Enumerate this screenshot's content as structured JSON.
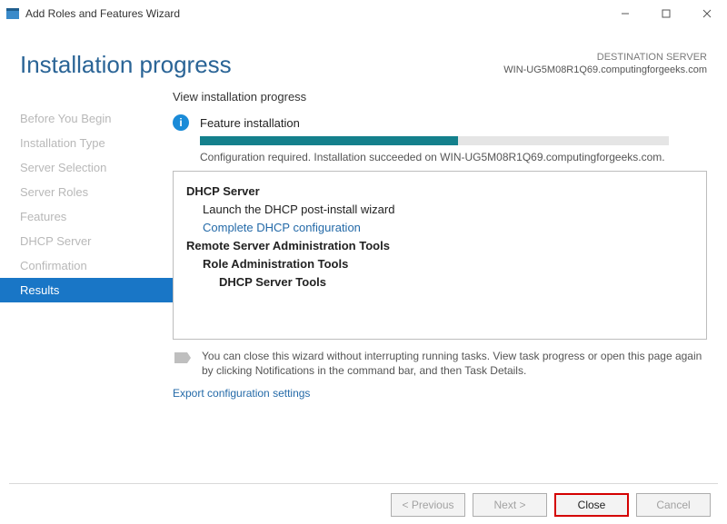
{
  "titlebar": {
    "title": "Add Roles and Features Wizard"
  },
  "header": {
    "title": "Installation progress",
    "dest_label": "DESTINATION SERVER",
    "dest_server": "WIN-UG5M08R1Q69.computingforgeeks.com"
  },
  "sidebar": {
    "items": [
      {
        "label": "Before You Begin"
      },
      {
        "label": "Installation Type"
      },
      {
        "label": "Server Selection"
      },
      {
        "label": "Server Roles"
      },
      {
        "label": "Features"
      },
      {
        "label": "DHCP Server"
      },
      {
        "label": "Confirmation"
      },
      {
        "label": "Results"
      }
    ]
  },
  "main": {
    "section_heading": "View installation progress",
    "feature_label": "Feature installation",
    "status_message": "Configuration required. Installation succeeded on WIN-UG5M08R1Q69.computingforgeeks.com.",
    "details": {
      "group1_head": "DHCP Server",
      "group1_line": "Launch the DHCP post-install wizard",
      "group1_link": "Complete DHCP configuration",
      "group2_head": "Remote Server Administration Tools",
      "group2_sub1": "Role Administration Tools",
      "group2_sub2": "DHCP Server Tools"
    },
    "note": "You can close this wizard without interrupting running tasks. View task progress or open this page again by clicking Notifications in the command bar, and then Task Details.",
    "export_link": "Export configuration settings"
  },
  "footer": {
    "previous": "< Previous",
    "next": "Next >",
    "close": "Close",
    "cancel": "Cancel"
  }
}
